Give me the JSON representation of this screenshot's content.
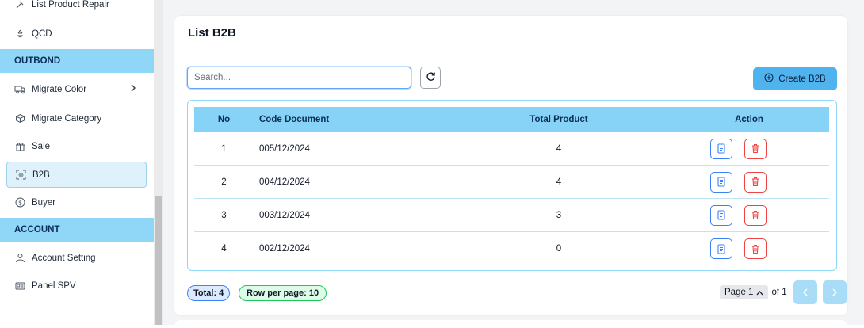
{
  "sidebar": {
    "partial_item": "List Product Repair",
    "qcd": "QCD",
    "outbond_header": "OUTBOND",
    "migrate_color": "Migrate Color",
    "migrate_category": "Migrate Category",
    "sale": "Sale",
    "b2b": "B2B",
    "buyer": "Buyer",
    "account_header": "ACCOUNT",
    "account_setting": "Account Setting",
    "panel_spv": "Panel SPV"
  },
  "main": {
    "title": "List B2B",
    "search_placeholder": "Search...",
    "create_label": "Create B2B",
    "columns": {
      "no": "No",
      "code": "Code Document",
      "total": "Total Product",
      "action": "Action"
    },
    "rows": [
      {
        "no": "1",
        "code": "005/12/2024",
        "total": "4"
      },
      {
        "no": "2",
        "code": "004/12/2024",
        "total": "4"
      },
      {
        "no": "3",
        "code": "003/12/2024",
        "total": "3"
      },
      {
        "no": "4",
        "code": "002/12/2024",
        "total": "0"
      }
    ],
    "footer": {
      "total": "Total: 4",
      "rows_per_page": "Row per page: 10",
      "page_label": "Page 1",
      "of_label": "of 1"
    }
  },
  "colors": {
    "accent": "#4fb3ee",
    "header_bg": "#8fd6f7",
    "delete": "#ef4444",
    "detail": "#3b82f6"
  }
}
